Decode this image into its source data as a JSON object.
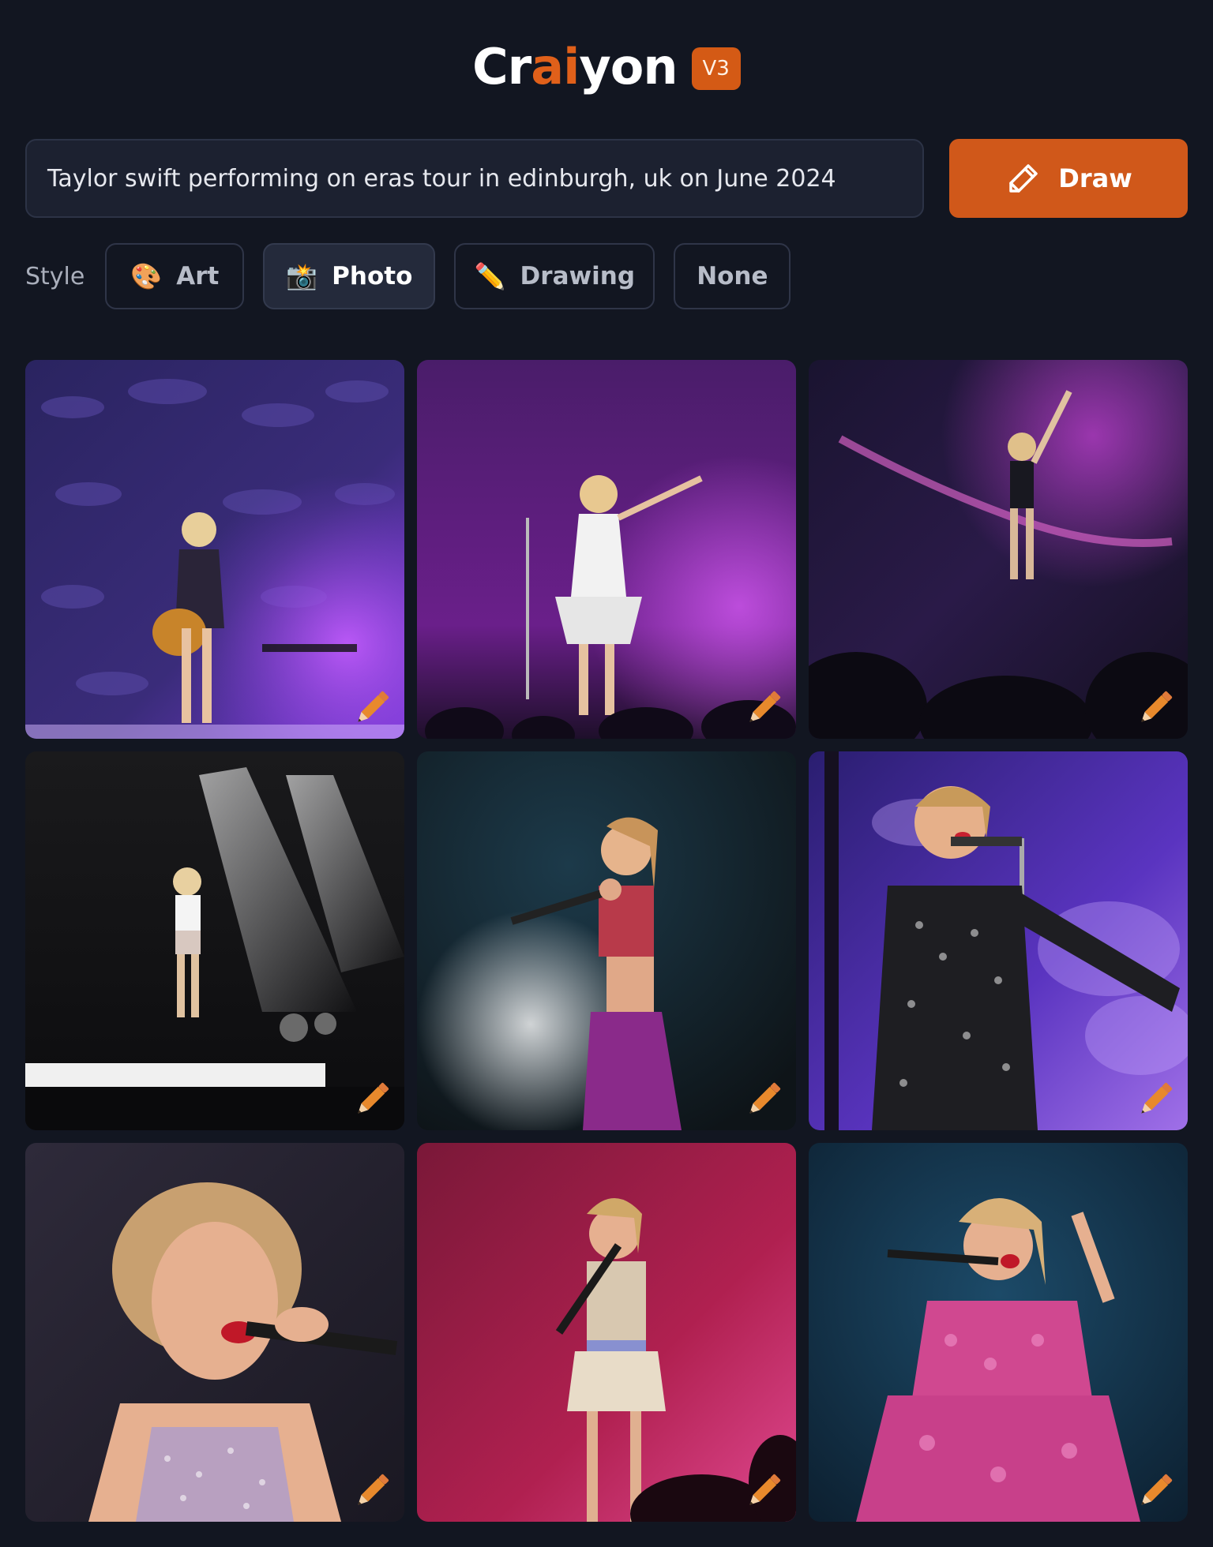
{
  "brand": {
    "prefix": "Cr",
    "accent": "ai",
    "suffix": "yon",
    "version": "V3",
    "accent_color": "#e0601a"
  },
  "prompt": {
    "value": "Taylor swift performing on eras tour in edinburgh, uk on June 2024"
  },
  "draw_button": {
    "label": "Draw",
    "icon": "pencil-icon",
    "color": "#d0581a"
  },
  "style": {
    "label": "Style",
    "selected": "Photo",
    "options": [
      {
        "label": "Art",
        "icon": "palette-icon",
        "glyph": "🎨"
      },
      {
        "label": "Photo",
        "icon": "camera-flash-icon",
        "glyph": "📸"
      },
      {
        "label": "Drawing",
        "icon": "pencil-icon",
        "glyph": "✏️"
      },
      {
        "label": "None",
        "icon": "",
        "glyph": ""
      }
    ]
  },
  "results": {
    "count": 9,
    "tiles": [
      {
        "scene": "guitar-performer-purple-crowd",
        "edit_icon": "pencil-icon"
      },
      {
        "scene": "white-dress-at-mic-stand-purple",
        "edit_icon": "pencil-icon"
      },
      {
        "scene": "arm-raised-purple-stage",
        "edit_icon": "pencil-icon"
      },
      {
        "scene": "white-top-spotlights-dark-stage",
        "edit_icon": "pencil-icon"
      },
      {
        "scene": "singing-red-top-teal-backdrop",
        "edit_icon": "pencil-icon"
      },
      {
        "scene": "sequin-dress-purple-smoke",
        "edit_icon": "pencil-icon"
      },
      {
        "scene": "closeup-red-lips-microphone",
        "edit_icon": "pencil-icon"
      },
      {
        "scene": "fringe-dress-red-backdrop",
        "edit_icon": "pencil-icon"
      },
      {
        "scene": "pink-ruffle-dress-blue-backdrop",
        "edit_icon": "pencil-icon"
      }
    ]
  }
}
